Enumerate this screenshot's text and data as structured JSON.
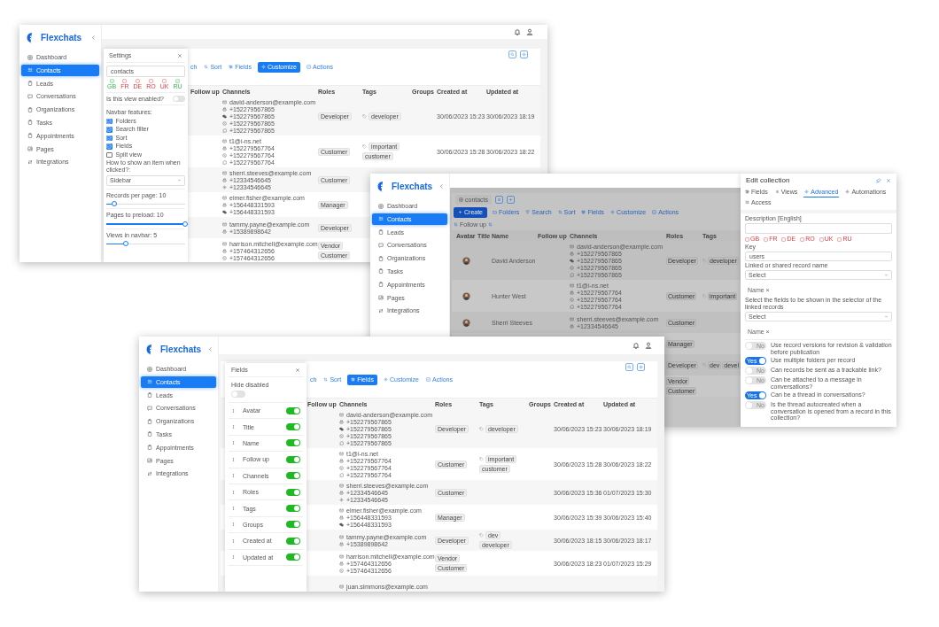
{
  "windows": [
    {
      "kind": "settings",
      "dimmed": false,
      "sidebar": {
        "brand": "Flexchats",
        "items": [
          {
            "label": "Dashboard",
            "selected": false
          },
          {
            "label": "Contacts",
            "selected": true
          },
          {
            "label": "Leads",
            "selected": false
          },
          {
            "label": "Conversations",
            "selected": false
          },
          {
            "label": "Organizations",
            "selected": false
          },
          {
            "label": "Tasks",
            "selected": false
          },
          {
            "label": "Appointments",
            "selected": false
          },
          {
            "label": "Pages",
            "selected": false
          },
          {
            "label": "Integrations",
            "selected": false
          }
        ]
      },
      "toolbar": [
        {
          "kind": "text",
          "label": "ch",
          "selected": false
        },
        {
          "kind": "sort",
          "label": "Sort",
          "selected": false
        },
        {
          "kind": "fields",
          "label": "Fields",
          "selected": false
        },
        {
          "kind": "customize",
          "label": "Customize",
          "selected": true
        },
        {
          "kind": "actions",
          "label": "Actions",
          "selected": false
        }
      ],
      "table": {
        "columns": [
          {
            "kind": "follow_up",
            "label": "Follow up"
          },
          {
            "kind": "channels",
            "label": "Channels"
          },
          {
            "kind": "roles",
            "label": "Roles"
          },
          {
            "kind": "tags",
            "label": "Tags"
          },
          {
            "kind": "groups",
            "label": "Groups"
          },
          {
            "kind": "created",
            "label": "Created at"
          },
          {
            "kind": "updated",
            "label": "Updated at"
          }
        ],
        "rows": [
          {
            "channels": [
              {
                "kind": "email",
                "text": "david-anderson@example.com"
              },
              {
                "kind": "phone",
                "text": "+152279567865"
              },
              {
                "kind": "wechat",
                "text": "+152279567865"
              },
              {
                "kind": "viber",
                "text": "+152279567865"
              },
              {
                "kind": "whatsapp",
                "text": "+152279567865"
              }
            ],
            "roles": [
              "Developer"
            ],
            "tags": [
              "developer"
            ],
            "created_at": "30/06/2023 15:23",
            "updated_at": "30/06/2023 18:19"
          },
          {
            "channels": [
              {
                "kind": "email",
                "text": "t1@i-ns.net"
              },
              {
                "kind": "phone",
                "text": "+152279567764"
              },
              {
                "kind": "viber",
                "text": "+152279567764"
              },
              {
                "kind": "whatsapp",
                "text": "+152279567764"
              }
            ],
            "roles": [
              "Customer"
            ],
            "tags": [
              "important",
              "customer"
            ],
            "created_at": "30/06/2023 15:28",
            "updated_at": "30/06/2023 18:22"
          },
          {
            "channels": [
              {
                "kind": "email",
                "text": "sherri.steeves@example.com"
              },
              {
                "kind": "phone",
                "text": "+12334546645"
              },
              {
                "kind": "settings",
                "text": "+12334546645"
              }
            ],
            "roles": [
              "Customer"
            ]
          },
          {
            "channels": [
              {
                "kind": "email",
                "text": "elmer.fisher@example.com"
              },
              {
                "kind": "phone",
                "text": "+156448331593"
              },
              {
                "kind": "wechat",
                "text": "+156448331593"
              }
            ],
            "roles": [
              "Manager"
            ]
          },
          {
            "channels": [
              {
                "kind": "email",
                "text": "tammy.payne@example.com"
              },
              {
                "kind": "phone",
                "text": "+15389898642"
              }
            ],
            "roles": [
              "Developer"
            ]
          },
          {
            "channels": [
              {
                "kind": "email",
                "text": "harrison.mitchell@example.com"
              },
              {
                "kind": "phone",
                "text": "+157464312656"
              },
              {
                "kind": "viber",
                "text": "+157464312656"
              }
            ],
            "roles": [
              "Vendor",
              "Customer"
            ]
          }
        ]
      },
      "panel": {
        "title": "Settings",
        "view_name": "contacts",
        "languages": [
          {
            "code": "GB",
            "done": true
          },
          {
            "code": "FR",
            "done": false
          },
          {
            "code": "DE",
            "done": false
          },
          {
            "code": "RO",
            "done": false
          },
          {
            "code": "UK",
            "done": false
          },
          {
            "code": "RU",
            "done": true
          }
        ],
        "enabled_label": "Is this view enabled?",
        "enabled": false,
        "features_label": "Navbar features:",
        "features": [
          {
            "label": "Folders",
            "checked": true
          },
          {
            "label": "Search filter",
            "checked": true
          },
          {
            "label": "Sort",
            "checked": true
          },
          {
            "label": "Fields",
            "checked": true
          },
          {
            "label": "Split view",
            "checked": false
          }
        ],
        "click_label": "How to show an item when clicked?:",
        "click_value": "Sidebar",
        "sliders": [
          {
            "label": "Records per page: 10",
            "level": 0.1
          },
          {
            "label": "Pages to preload: 10",
            "level": 1
          },
          {
            "label": "Views in navbar: 5",
            "level": 0.25
          }
        ]
      }
    },
    {
      "kind": "edit_collection",
      "dimmed": true,
      "sidebar": {
        "brand": "Flexchats",
        "items": [
          {
            "label": "Dashboard",
            "selected": false
          },
          {
            "label": "Contacts",
            "selected": true
          },
          {
            "label": "Leads",
            "selected": false
          },
          {
            "label": "Conversations",
            "selected": false
          },
          {
            "label": "Organizations",
            "selected": false
          },
          {
            "label": "Tasks",
            "selected": false
          },
          {
            "label": "Appointments",
            "selected": false
          },
          {
            "label": "Pages",
            "selected": false
          },
          {
            "label": "Integrations",
            "selected": false
          }
        ]
      },
      "view_tab": "contacts",
      "toolbar": [
        {
          "kind": "create",
          "label": "Create",
          "selected": true
        },
        {
          "kind": "folders",
          "label": "Folders",
          "selected": false
        },
        {
          "kind": "search",
          "label": "Search",
          "selected": false
        },
        {
          "kind": "sort",
          "label": "Sort",
          "selected": false
        },
        {
          "kind": "fields",
          "label": "Fields",
          "selected": false
        },
        {
          "kind": "customize",
          "label": "Customize",
          "selected": false
        },
        {
          "kind": "actions",
          "label": "Actions",
          "selected": false
        }
      ],
      "sort_chip": "Follow up",
      "table": {
        "columns": [
          {
            "kind": "avatar",
            "label": "Avatar"
          },
          {
            "kind": "title",
            "label": "Title"
          },
          {
            "kind": "name",
            "label": "Name"
          },
          {
            "kind": "follow_up",
            "label": "Follow up"
          },
          {
            "kind": "channels",
            "label": "Channels"
          },
          {
            "kind": "roles",
            "label": "Roles"
          },
          {
            "kind": "tags",
            "label": "Tags"
          }
        ],
        "rows": [
          {
            "avatar": {
              "kind": "picture"
            },
            "name": "David Anderson",
            "channels": [
              {
                "kind": "email",
                "text": "david-anderson@example.com"
              },
              {
                "kind": "phone",
                "text": "+152279567865"
              },
              {
                "kind": "wechat",
                "text": "+152279567865"
              },
              {
                "kind": "viber",
                "text": "+152279567865"
              },
              {
                "kind": "whatsapp",
                "text": "+152279567865"
              }
            ],
            "roles": [
              "Developer"
            ],
            "tags": [
              "developer"
            ]
          },
          {
            "avatar": {
              "kind": "picture"
            },
            "name": "Hunter West",
            "channels": [
              {
                "kind": "email",
                "text": "t1@i-ns.net"
              },
              {
                "kind": "phone",
                "text": "+152279567764"
              },
              {
                "kind": "viber",
                "text": "+152279567764"
              },
              {
                "kind": "whatsapp",
                "text": "+152279567764"
              }
            ],
            "roles": [
              "Customer"
            ],
            "tags": [
              "important"
            ]
          },
          {
            "avatar": {
              "kind": "picture"
            },
            "name": "Sherri Steeves",
            "channels": [
              {
                "kind": "email",
                "text": "sherri.steeves@example.com"
              },
              {
                "kind": "phone",
                "text": "+12334546645"
              }
            ],
            "roles": [
              "Customer"
            ]
          },
          {
            "roles": [
              "Manager"
            ]
          },
          {
            "roles": [
              "Developer"
            ],
            "tags": [
              "dev",
              "devel"
            ]
          },
          {
            "roles": [
              "Vendor",
              "Customer"
            ]
          }
        ]
      },
      "panel": {
        "title": "Edit collection",
        "tabs": [
          {
            "label": "Fields",
            "selected": false
          },
          {
            "label": "Views",
            "selected": false
          },
          {
            "label": "Advanced",
            "selected": true
          },
          {
            "label": "Automations",
            "selected": false
          },
          {
            "label": "Access",
            "selected": false
          }
        ],
        "description_label": "Description [English]",
        "languages": [
          {
            "code": "GB",
            "done": false
          },
          {
            "code": "FR",
            "done": false
          },
          {
            "code": "DE",
            "done": false
          },
          {
            "code": "RO",
            "done": false
          },
          {
            "code": "UK",
            "done": false
          },
          {
            "code": "RU",
            "done": false
          }
        ],
        "key_label": "Key",
        "key_value": "users",
        "selects": [
          {
            "label": "Linked or shared record name",
            "value": "Select",
            "chip": "Name ×"
          },
          {
            "label": "Select the fields to be shown in the selector of the linked records",
            "value": "Select",
            "chip": "Name ×"
          }
        ],
        "toggles": [
          {
            "label": "Use record versions for revision & validation before publication",
            "on": false,
            "text": "No"
          },
          {
            "label": "Use multiple folders per record",
            "on": true,
            "text": "Yes"
          },
          {
            "label": "Can records be sent as a trackable link?",
            "on": false,
            "text": "No"
          },
          {
            "label": "Can be attached to a message in conversations?",
            "on": false,
            "text": "No"
          },
          {
            "label": "Can be a thread in conversations?",
            "on": true,
            "text": "Yes"
          },
          {
            "label": "Is the thread autocreated when a conversation is opened from a record in this collection?",
            "on": false,
            "text": "No"
          }
        ]
      }
    },
    {
      "kind": "fields",
      "dimmed": false,
      "sidebar": {
        "brand": "Flexchats",
        "items": [
          {
            "label": "Dashboard",
            "selected": false
          },
          {
            "label": "Contacts",
            "selected": true
          },
          {
            "label": "Leads",
            "selected": false
          },
          {
            "label": "Conversations",
            "selected": false
          },
          {
            "label": "Organizations",
            "selected": false
          },
          {
            "label": "Tasks",
            "selected": false
          },
          {
            "label": "Appointments",
            "selected": false
          },
          {
            "label": "Pages",
            "selected": false
          },
          {
            "label": "Integrations",
            "selected": false
          }
        ]
      },
      "toolbar": [
        {
          "kind": "text",
          "label": "ch",
          "selected": false
        },
        {
          "kind": "sort",
          "label": "Sort",
          "selected": false
        },
        {
          "kind": "fields",
          "label": "Fields",
          "selected": true
        },
        {
          "kind": "customize",
          "label": "Customize",
          "selected": false
        },
        {
          "kind": "actions",
          "label": "Actions",
          "selected": false
        }
      ],
      "table": {
        "columns": [
          {
            "kind": "follow_up",
            "label": "Follow up"
          },
          {
            "kind": "channels",
            "label": "Channels"
          },
          {
            "kind": "roles",
            "label": "Roles"
          },
          {
            "kind": "tags",
            "label": "Tags"
          },
          {
            "kind": "groups",
            "label": "Groups"
          },
          {
            "kind": "created",
            "label": "Created at"
          },
          {
            "kind": "updated",
            "label": "Updated at"
          }
        ],
        "rows": [
          {
            "channels": [
              {
                "kind": "email",
                "text": "david-anderson@example.com"
              },
              {
                "kind": "phone",
                "text": "+152279567865"
              },
              {
                "kind": "wechat",
                "text": "+152279567865"
              },
              {
                "kind": "viber",
                "text": "+152279567865"
              },
              {
                "kind": "whatsapp",
                "text": "+152279567865"
              }
            ],
            "roles": [
              "Developer"
            ],
            "tags": [
              "developer"
            ],
            "created_at": "30/06/2023 15:23",
            "updated_at": "30/06/2023 18:19"
          },
          {
            "channels": [
              {
                "kind": "email",
                "text": "t1@i-ns.net"
              },
              {
                "kind": "phone",
                "text": "+152279567764"
              },
              {
                "kind": "viber",
                "text": "+152279567764"
              },
              {
                "kind": "whatsapp",
                "text": "+152279567764"
              }
            ],
            "roles": [
              "Customer"
            ],
            "tags": [
              "important",
              "customer"
            ],
            "created_at": "30/06/2023 15:28",
            "updated_at": "30/06/2023 18:22"
          },
          {
            "channels": [
              {
                "kind": "email",
                "text": "sherri.steeves@example.com"
              },
              {
                "kind": "phone",
                "text": "+12334546645"
              },
              {
                "kind": "settings",
                "text": "+12334546645"
              }
            ],
            "roles": [
              "Customer"
            ],
            "created_at": "30/06/2023 15:36",
            "updated_at": "01/07/2023 15:30"
          },
          {
            "channels": [
              {
                "kind": "email",
                "text": "elmer.fisher@example.com"
              },
              {
                "kind": "phone",
                "text": "+156448331593"
              },
              {
                "kind": "wechat",
                "text": "+156448331593"
              }
            ],
            "roles": [
              "Manager"
            ],
            "created_at": "30/06/2023 15:39",
            "updated_at": "30/06/2023 15:40"
          },
          {
            "channels": [
              {
                "kind": "email",
                "text": "tammy.payne@example.com"
              },
              {
                "kind": "phone",
                "text": "+15389898642"
              }
            ],
            "roles": [
              "Developer"
            ],
            "tags": [
              "dev",
              "developer"
            ],
            "created_at": "30/06/2023 18:15",
            "updated_at": "30/06/2023 18:17"
          },
          {
            "channels": [
              {
                "kind": "email",
                "text": "harrison.mitchell@example.com"
              },
              {
                "kind": "phone",
                "text": "+157464312656"
              },
              {
                "kind": "viber",
                "text": "+157464312656"
              }
            ],
            "roles": [
              "Vendor",
              "Customer"
            ],
            "created_at": "30/06/2023 18:23",
            "updated_at": "01/07/2023 15:29"
          },
          {
            "channels": [
              {
                "kind": "email",
                "text": "juan.simmons@example.com"
              }
            ]
          }
        ]
      },
      "panel": {
        "title": "Fields",
        "hide_label": "Hide disabled",
        "hide_disabled": false,
        "fields": [
          {
            "label": "Avatar",
            "on": true
          },
          {
            "label": "Title",
            "on": true
          },
          {
            "label": "Name",
            "on": true
          },
          {
            "label": "Follow up",
            "on": true
          },
          {
            "label": "Channels",
            "on": true
          },
          {
            "label": "Roles",
            "on": true
          },
          {
            "label": "Tags",
            "on": true
          },
          {
            "label": "Groups",
            "on": true
          },
          {
            "label": "Created at",
            "on": true
          },
          {
            "label": "Updated at",
            "on": true
          }
        ]
      }
    }
  ]
}
